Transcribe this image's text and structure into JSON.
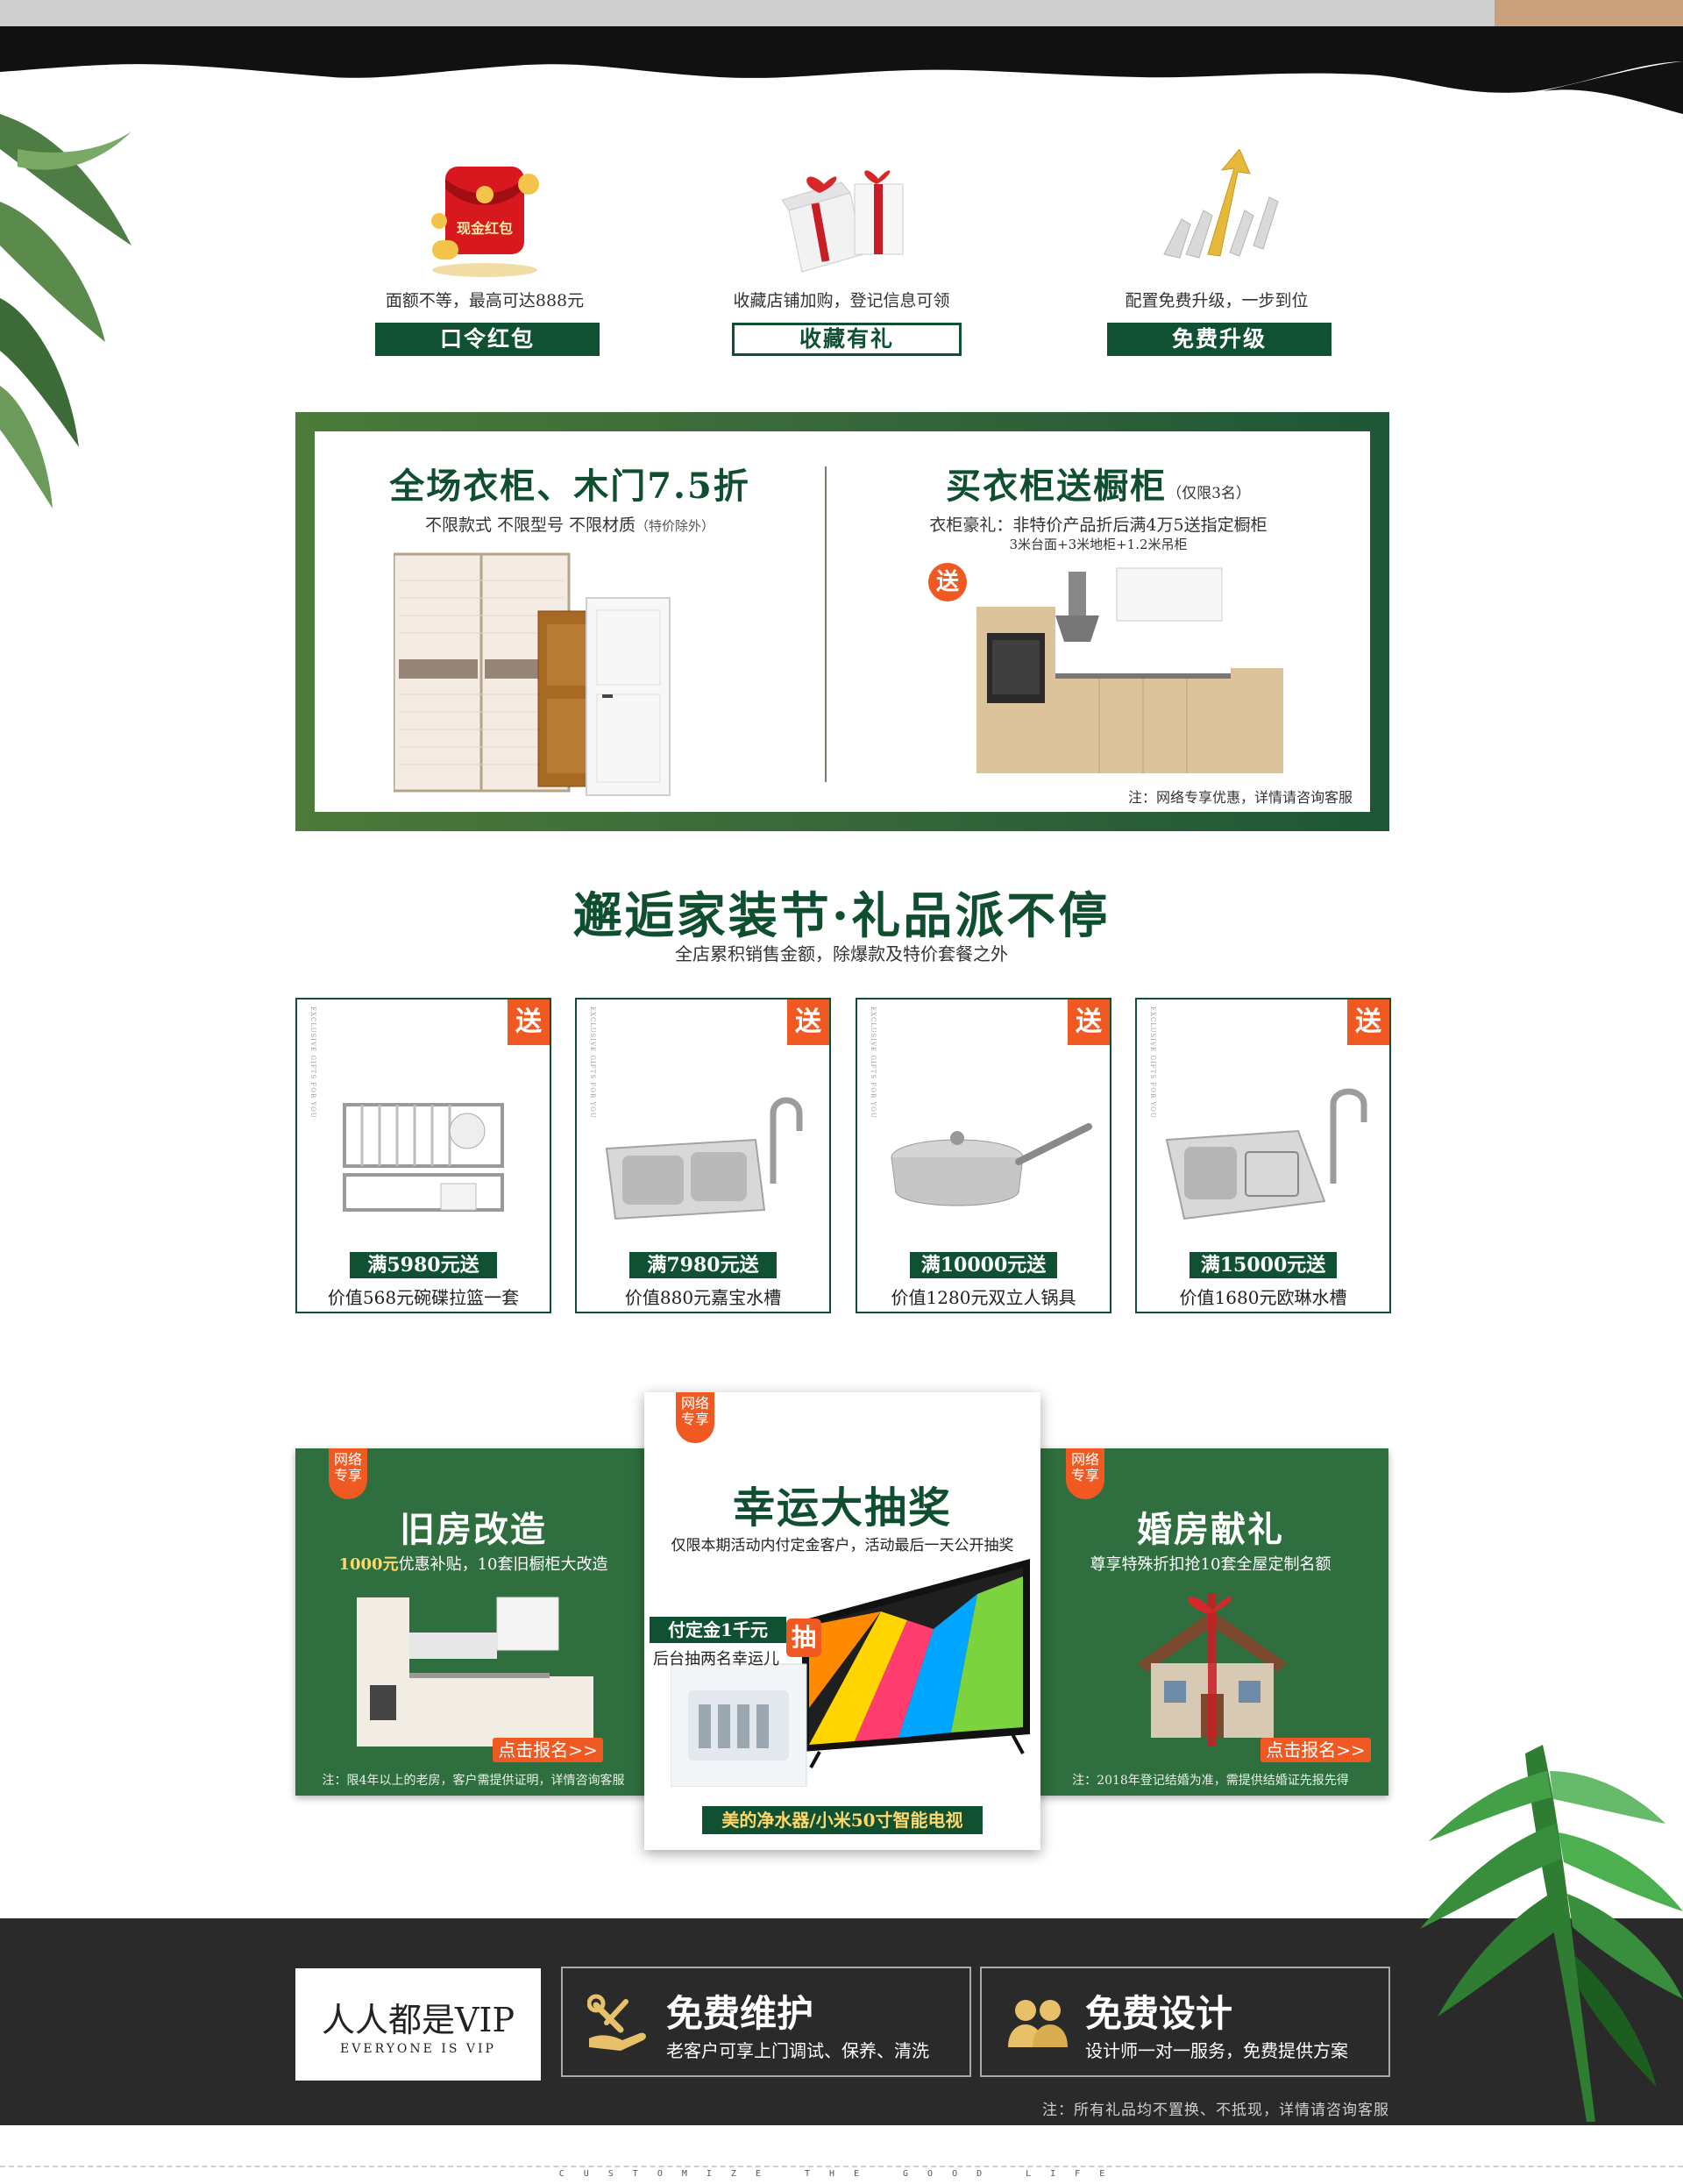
{
  "perks": [
    {
      "art_label": "现金红包",
      "desc": "面额不等，最高可达888元",
      "tag": "口令红包",
      "style": "filled"
    },
    {
      "art_label": "",
      "desc": "收藏店铺加购，登记信息可领",
      "tag": "收藏有礼",
      "style": "outlined"
    },
    {
      "art_label": "",
      "desc": "配置免费升级，一步到位",
      "tag": "免费升级",
      "style": "filled"
    }
  ],
  "promo": {
    "left": {
      "title": "全场衣柜、木门7.5折",
      "sub_main": "不限款式  不限型号  不限材质",
      "sub_note": "（特价除外）"
    },
    "right": {
      "title": "买衣柜送橱柜",
      "title_note": "（仅限3名）",
      "sub": "衣柜豪礼：非特价产品折后满4万5送指定橱柜",
      "small": "3米台面+3米地柜+1.2米吊柜",
      "badge": "送",
      "footnote": "注：网络专享优惠，详情请咨询客服"
    }
  },
  "gifts": {
    "title": "邂逅家装节·礼品派不停",
    "subtitle": "全店累积销售金额，除爆款及特价套餐之外",
    "badge": "送",
    "items": [
      {
        "condition": "满5980元送",
        "value": "价值568元碗碟拉篮一套"
      },
      {
        "condition": "满7980元送",
        "value": "价值880元嘉宝水槽"
      },
      {
        "condition": "满10000元送",
        "value": "价值1280元双立人锅具"
      },
      {
        "condition": "满15000元送",
        "value": "价值1680元欧琳水槽"
      }
    ]
  },
  "activities": {
    "badge_line1": "网络",
    "badge_line2": "专享",
    "left": {
      "title": "旧房改造",
      "sub_highlight": "1000元",
      "sub_rest": "优惠补贴，10套旧橱柜大改造",
      "cta": "点击报名>>",
      "note": "注：限4年以上的老房，客户需提供证明，详情咨询客服"
    },
    "center": {
      "title": "幸运大抽奖",
      "sub": "仅限本期活动内付定金客户，活动最后一天公开抽奖",
      "deposit": "付定金1千元",
      "draw_badge": "抽",
      "draw_text": "后台抽两名幸运儿",
      "prize": "美的净水器/小米50寸智能电视"
    },
    "right": {
      "title": "婚房献礼",
      "sub": "尊享特殊折扣抢10套全屋定制名额",
      "cta": "点击报名>>",
      "note": "注：2018年登记结婚为准，需提供结婚证先报先得"
    }
  },
  "services": {
    "vip_title": "人人都是VIP",
    "vip_sub": "EVERYONE IS VIP",
    "items": [
      {
        "title": "免费维护",
        "desc": "老客户可享上门调试、保养、清洗",
        "icon": "wrench-hand-icon"
      },
      {
        "title": "免费设计",
        "desc": "设计师一对一服务，免费提供方案",
        "icon": "designers-icon"
      }
    ],
    "note": "注：所有礼品均不置换、不抵现，详情请咨询客服"
  },
  "footer": {
    "text": "CUSTOMIZE THE GOOD LIFE"
  },
  "colors": {
    "brand_green": "#0f5132",
    "accent_orange": "#f05a22",
    "band_dark": "#2a2a2a"
  }
}
